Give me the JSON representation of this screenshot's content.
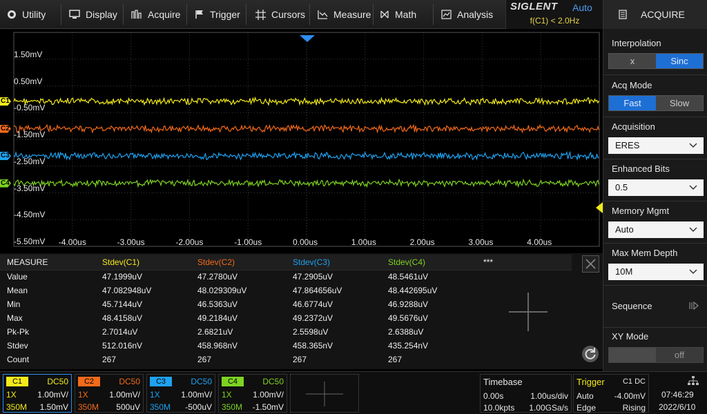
{
  "menu": {
    "items": [
      {
        "label": "Utility",
        "icon": "utility-icon"
      },
      {
        "label": "Display",
        "icon": "display-icon"
      },
      {
        "label": "Acquire",
        "icon": "acquire-icon"
      },
      {
        "label": "Trigger",
        "icon": "trigger-flag-icon"
      },
      {
        "label": "Cursors",
        "icon": "cursors-icon"
      },
      {
        "label": "Measure",
        "icon": "measure-icon"
      },
      {
        "label": "Math",
        "icon": "math-icon"
      },
      {
        "label": "Analysis",
        "icon": "analysis-icon"
      }
    ]
  },
  "brand": {
    "logo": "SIGLENT",
    "mode": "Auto",
    "freq": "f(C1) < 2.0Hz"
  },
  "panel": {
    "title": "ACQUIRE",
    "interpolation": {
      "label": "Interpolation",
      "options": [
        "x",
        "Sinc"
      ],
      "selected": "Sinc"
    },
    "acq_mode": {
      "label": "Acq Mode",
      "options": [
        "Fast",
        "Slow"
      ],
      "selected": "Fast"
    },
    "acquisition": {
      "label": "Acquisition",
      "value": "ERES"
    },
    "enhanced_bits": {
      "label": "Enhanced Bits",
      "value": "0.5"
    },
    "memory_mgmt": {
      "label": "Memory Mgmt",
      "value": "Auto"
    },
    "max_mem_depth": {
      "label": "Max Mem Depth",
      "value": "10M"
    },
    "sequence": {
      "label": "Sequence"
    },
    "xy_mode": {
      "label": "XY Mode",
      "value": "off"
    }
  },
  "grid": {
    "y_labels": [
      "1.50mV",
      "0.50mV",
      "-0.50mV",
      "-1.50mV",
      "-2.50mV",
      "-3.50mV",
      "-4.50mV",
      "-5.50mV"
    ],
    "x_labels": [
      "-4.00us",
      "-3.00us",
      "-2.00us",
      "-1.00us",
      "0.00us",
      "1.00us",
      "2.00us",
      "3.00us",
      "4.00us"
    ],
    "channels": [
      {
        "name": "C1",
        "color": "#f2ea1a"
      },
      {
        "name": "C2",
        "color": "#f26a1a"
      },
      {
        "name": "C3",
        "color": "#1fa2f0"
      },
      {
        "name": "C4",
        "color": "#7ed321"
      }
    ]
  },
  "measure": {
    "header": "MEASURE",
    "columns": [
      "Stdev(C1)",
      "Stdev(C2)",
      "Stdev(C3)",
      "Stdev(C4)",
      "***"
    ],
    "rows": [
      {
        "label": "Value",
        "vals": [
          "47.1999uV",
          "47.2780uV",
          "47.2905uV",
          "48.5461uV"
        ]
      },
      {
        "label": "Mean",
        "vals": [
          "47.082948uV",
          "48.029309uV",
          "47.864656uV",
          "48.442695uV"
        ]
      },
      {
        "label": "Min",
        "vals": [
          "45.7144uV",
          "46.5363uV",
          "46.6774uV",
          "46.9288uV"
        ]
      },
      {
        "label": "Max",
        "vals": [
          "48.4158uV",
          "49.2184uV",
          "49.2372uV",
          "49.5676uV"
        ]
      },
      {
        "label": "Pk-Pk",
        "vals": [
          "2.7014uV",
          "2.6821uV",
          "2.5598uV",
          "2.6388uV"
        ]
      },
      {
        "label": "Stdev",
        "vals": [
          "512.016nV",
          "458.968nV",
          "458.365nV",
          "435.254nV"
        ]
      },
      {
        "label": "Count",
        "vals": [
          "267",
          "267",
          "267",
          "267"
        ]
      }
    ]
  },
  "bottom": {
    "channels": [
      {
        "tag": "C1",
        "coupling": "DC50",
        "probe": "1X",
        "scale": "1.00mV/",
        "bw": "350M",
        "offset": "1.50mV",
        "color": "#f2ea1a"
      },
      {
        "tag": "C2",
        "coupling": "DC50",
        "probe": "1X",
        "scale": "1.00mV/",
        "bw": "350M",
        "offset": "500uV",
        "color": "#f26a1a"
      },
      {
        "tag": "C3",
        "coupling": "DC50",
        "probe": "1X",
        "scale": "1.00mV/",
        "bw": "350M",
        "offset": "-500uV",
        "color": "#1fa2f0"
      },
      {
        "tag": "C4",
        "coupling": "DC50",
        "probe": "1X",
        "scale": "1.00mV/",
        "bw": "350M",
        "offset": "-1.50mV",
        "color": "#7ed321"
      }
    ],
    "timebase": {
      "label": "Timebase",
      "delay": "0.00s",
      "scale": "1.00us/div",
      "points": "10.0kpts",
      "rate": "1.00GSa/s"
    },
    "trigger": {
      "label": "Trigger",
      "source": "C1 DC",
      "mode": "Auto",
      "level": "-4.00mV",
      "type": "Edge",
      "slope": "Rising"
    },
    "clock": {
      "time": "07:46:29",
      "date": "2022/6/10"
    }
  }
}
